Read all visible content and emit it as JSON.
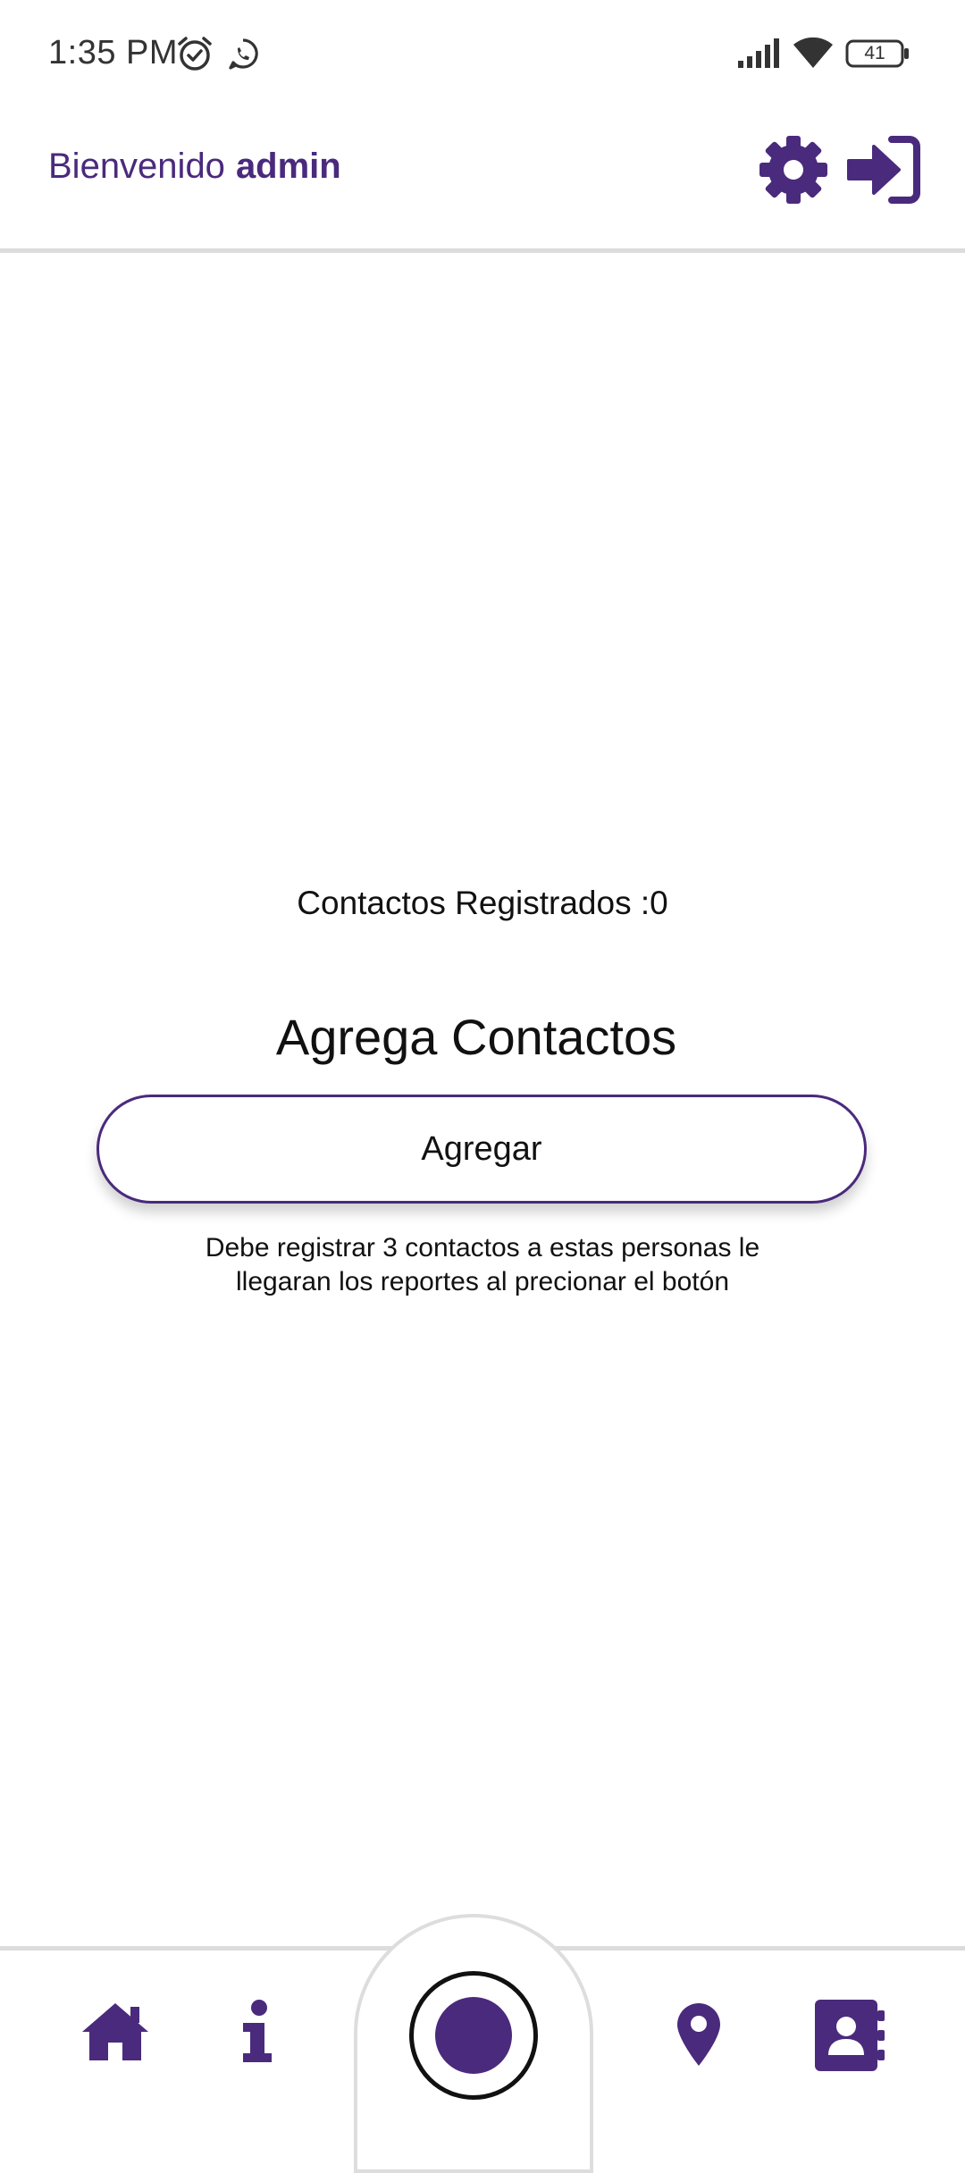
{
  "status_bar": {
    "time": "1:35 PM",
    "battery": "41",
    "icons": [
      "alarm-icon",
      "whatsapp-icon",
      "signal-icon",
      "wifi-icon",
      "battery-icon"
    ]
  },
  "header": {
    "welcome": "Bienvenido",
    "username": "admin",
    "icons": [
      "gear-icon",
      "sign-in-icon"
    ]
  },
  "main": {
    "registered_label": "Contactos Registrados :0",
    "heading": "Agrega Contactos",
    "add_button_label": "Agregar",
    "helper_line1": "Debe registrar 3 contactos a estas personas le",
    "helper_line2": "llegaran los reportes al precionar el botón"
  },
  "bottom_nav": {
    "items": [
      "home-icon",
      "info-icon",
      "record-icon",
      "location-pin-icon",
      "contacts-book-icon"
    ]
  },
  "colors": {
    "accent": "#4a2a7c",
    "divider": "#dcdcdc",
    "text": "#111111"
  }
}
